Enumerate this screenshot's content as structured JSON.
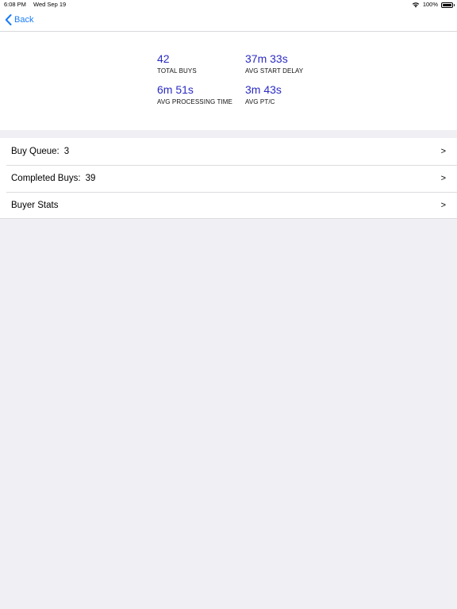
{
  "status_bar": {
    "time": "6:08 PM",
    "date": "Wed Sep 19",
    "battery": "100%",
    "icons": [
      "wifi-icon",
      "battery-icon"
    ]
  },
  "nav": {
    "back_label": "Back",
    "accent_color": "#1a7cf5"
  },
  "stats": {
    "value_color": "#2b2bc4",
    "total_buys": {
      "value": "42",
      "label": "TOTAL BUYS"
    },
    "avg_start_delay": {
      "value": "37m 33s",
      "label": "AVG START DELAY"
    },
    "avg_processing_time": {
      "value": "6m 51s",
      "label": "AVG PROCESSING TIME"
    },
    "avg_ptc": {
      "value": "3m 43s",
      "label": "AVG PT/C"
    }
  },
  "list": {
    "rows": [
      {
        "label": "Buy Queue:",
        "count": "3",
        "chevron": ">"
      },
      {
        "label": "Completed Buys:",
        "count": "39",
        "chevron": ">"
      },
      {
        "label": "Buyer Stats",
        "count": "",
        "chevron": ">"
      }
    ]
  }
}
